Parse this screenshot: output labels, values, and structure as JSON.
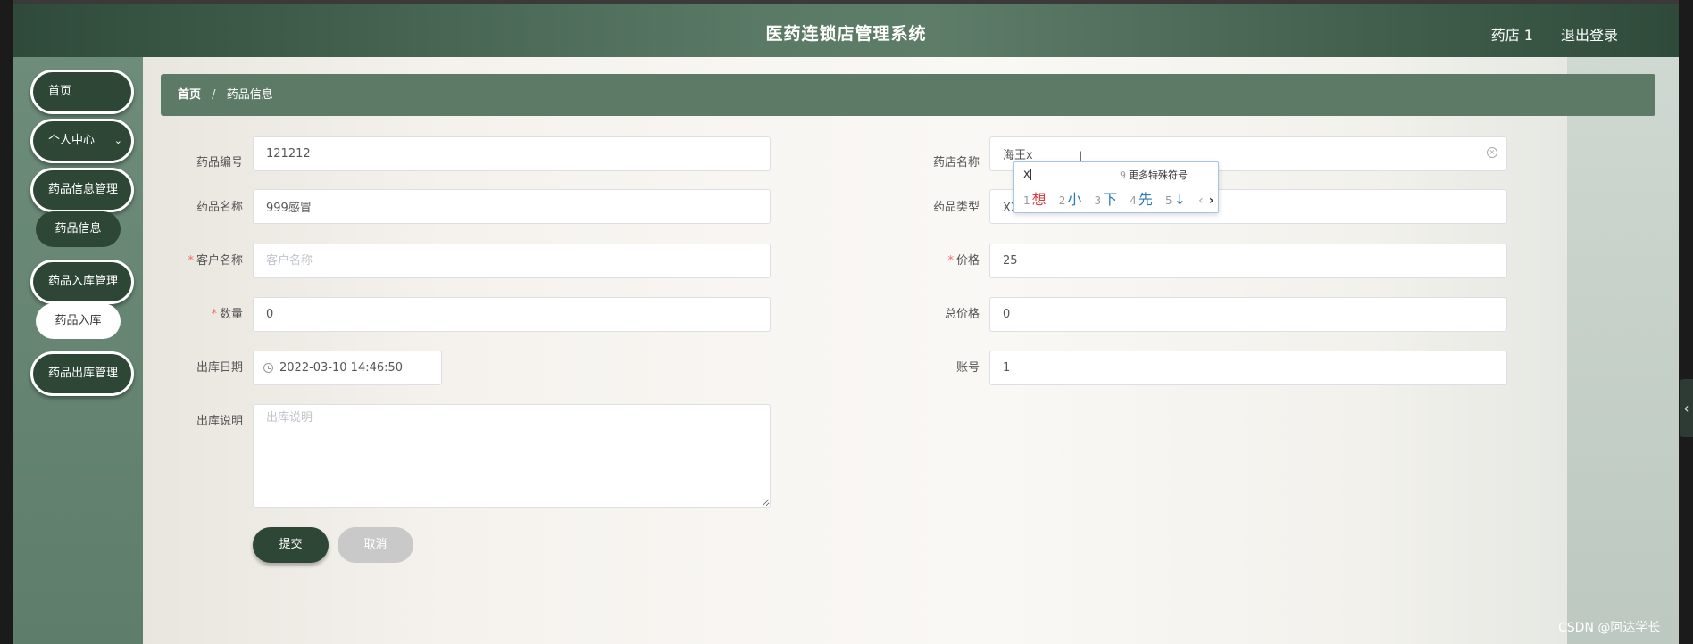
{
  "header": {
    "title": "医药连锁店管理系统",
    "user": "药店 1",
    "logout": "退出登录"
  },
  "sidebar": {
    "items": [
      {
        "label": "首页"
      },
      {
        "label": "个人中心",
        "chevron": "chevron-down-icon"
      },
      {
        "label": "药品信息管理",
        "chevron": "chevron-right-icon"
      },
      {
        "label": "药品入库管理",
        "chevron": "chevron-right-icon"
      },
      {
        "label": "药品出库管理",
        "chevron": "chevron-right-icon"
      }
    ],
    "subitems": {
      "drug_info": "药品信息",
      "drug_in": "药品入库"
    }
  },
  "breadcrumb": {
    "home": "首页",
    "separator": "/",
    "current": "药品信息"
  },
  "form": {
    "drug_code": {
      "label": "药品编号",
      "value": "121212"
    },
    "drug_name": {
      "label": "药品名称",
      "value": "999感冒"
    },
    "customer": {
      "label": "客户名称",
      "placeholder": "客户名称",
      "required": "*"
    },
    "quantity": {
      "label": "数量",
      "value": "0",
      "required": "*"
    },
    "out_date": {
      "label": "出库日期",
      "value": "2022-03-10 14:46:50"
    },
    "out_note": {
      "label": "出库说明",
      "placeholder": "出库说明"
    },
    "store_name": {
      "label": "药店名称",
      "value": "海王x"
    },
    "drug_type": {
      "label": "药品类型",
      "value": "XX类型"
    },
    "price": {
      "label": "价格",
      "value": "25",
      "required": "*"
    },
    "total_price": {
      "label": "总价格",
      "value": "0"
    },
    "account": {
      "label": "账号",
      "value": "1"
    }
  },
  "ime": {
    "typed": "x",
    "more_index": "9",
    "more": "更多特殊符号",
    "candidates": [
      {
        "index": "1",
        "text": "想"
      },
      {
        "index": "2",
        "text": "小"
      },
      {
        "index": "3",
        "text": "下"
      },
      {
        "index": "4",
        "text": "先"
      },
      {
        "index": "5",
        "text": "↓"
      }
    ],
    "prev": "‹",
    "next": "›"
  },
  "buttons": {
    "submit": "提交",
    "cancel": "取消"
  },
  "watermark": "CSDN @阿达学长",
  "colors": {
    "accent_dark": "#2e4636",
    "breadcrumb_bg": "#5c7a66",
    "required": "#f56c6c"
  }
}
